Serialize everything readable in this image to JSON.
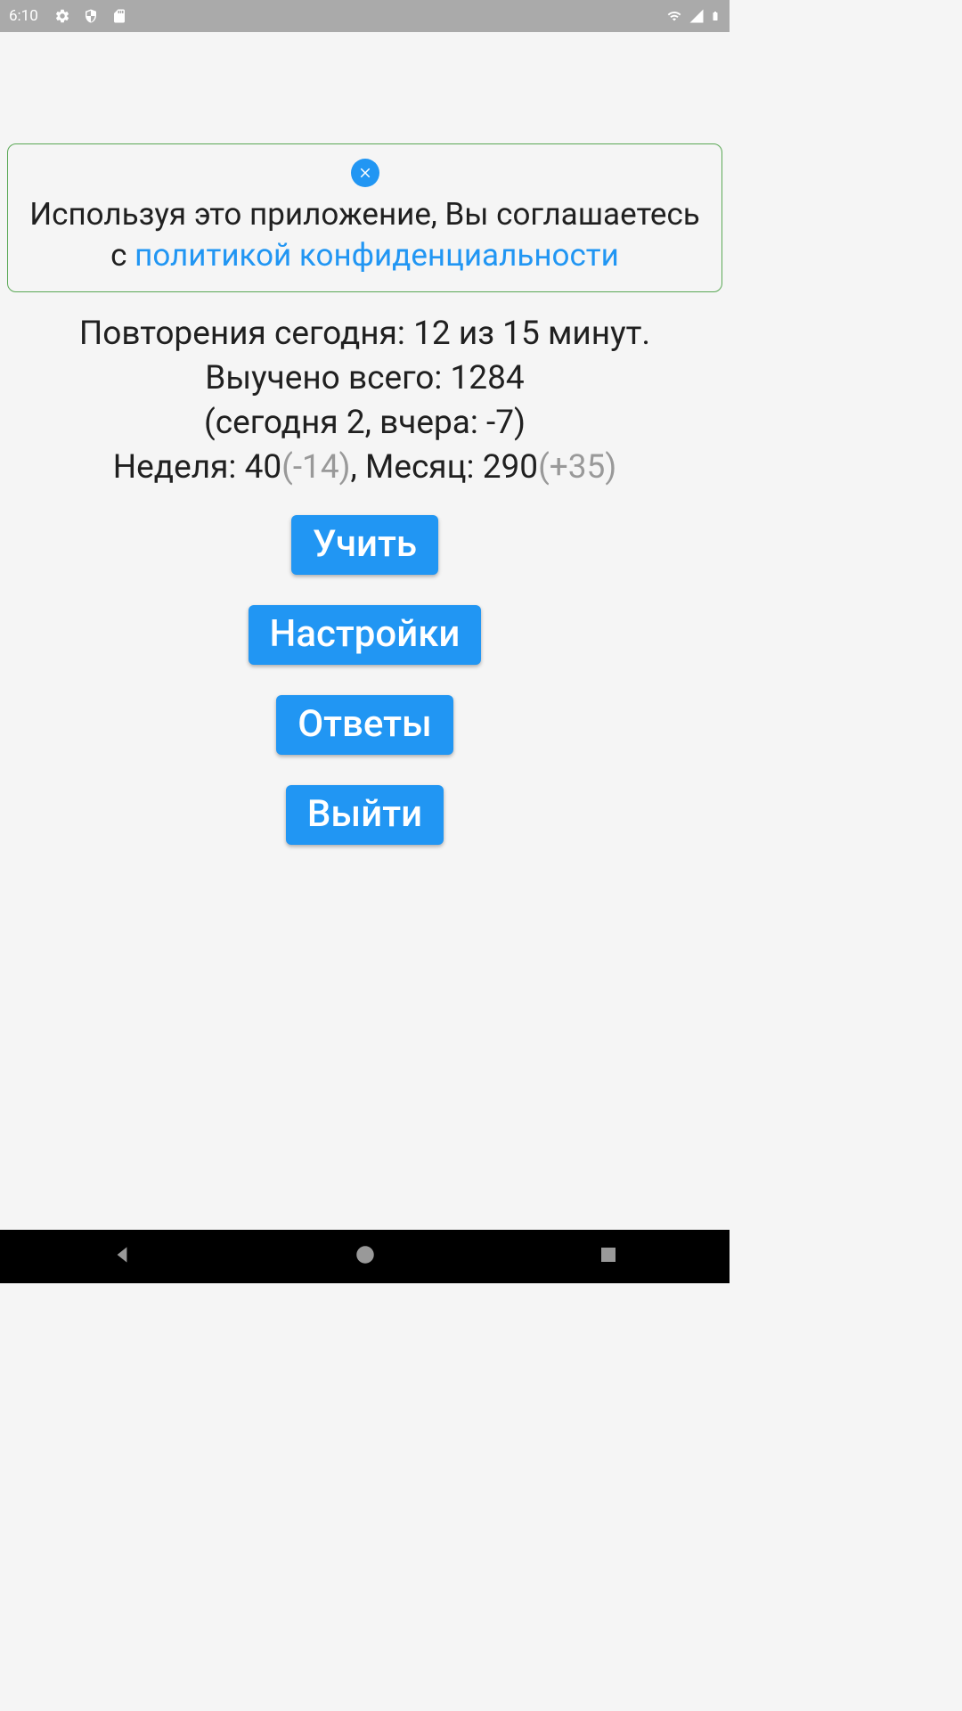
{
  "statusBar": {
    "time": "6:10"
  },
  "privacy": {
    "textPrefix": "Используя это приложение, Вы соглашаетесь с ",
    "linkText": "политикой конфиденциальности"
  },
  "stats": {
    "line1_prefix": "Повторения сегодня: ",
    "line1_done": "12",
    "line1_of": " из ",
    "line1_total": "15",
    "line1_suffix": " минут.",
    "line2_prefix": "Выучено всего: ",
    "line2_value": "1284",
    "line3_prefix": "(сегодня ",
    "line3_today": "2",
    "line3_mid": ", вчера: ",
    "line3_yesterday": "-7",
    "line3_suffix": ")",
    "line4_week_label": "Неделя: ",
    "line4_week_value": "40",
    "line4_week_delta": "(-14)",
    "line4_sep": ", ",
    "line4_month_label": "Месяц: ",
    "line4_month_value": "290",
    "line4_month_delta": "(+35)"
  },
  "buttons": {
    "learn": "Учить",
    "settings": "Настройки",
    "answers": "Ответы",
    "exit": "Выйти"
  }
}
